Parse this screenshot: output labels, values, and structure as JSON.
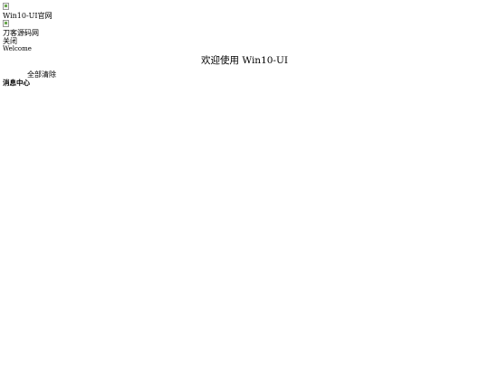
{
  "desktop": {
    "shortcuts": [
      {
        "label": "Win10-UI官网",
        "icon": "broken-image-icon"
      },
      {
        "label": "刀客源码网",
        "icon": "broken-image-icon"
      }
    ]
  },
  "popup": {
    "close_label": "关闭",
    "subtitle": "Welcome",
    "title": "欢迎使用 Win10-UI"
  },
  "message_center": {
    "clear_all_label": "全部清除",
    "title": "消息中心"
  }
}
